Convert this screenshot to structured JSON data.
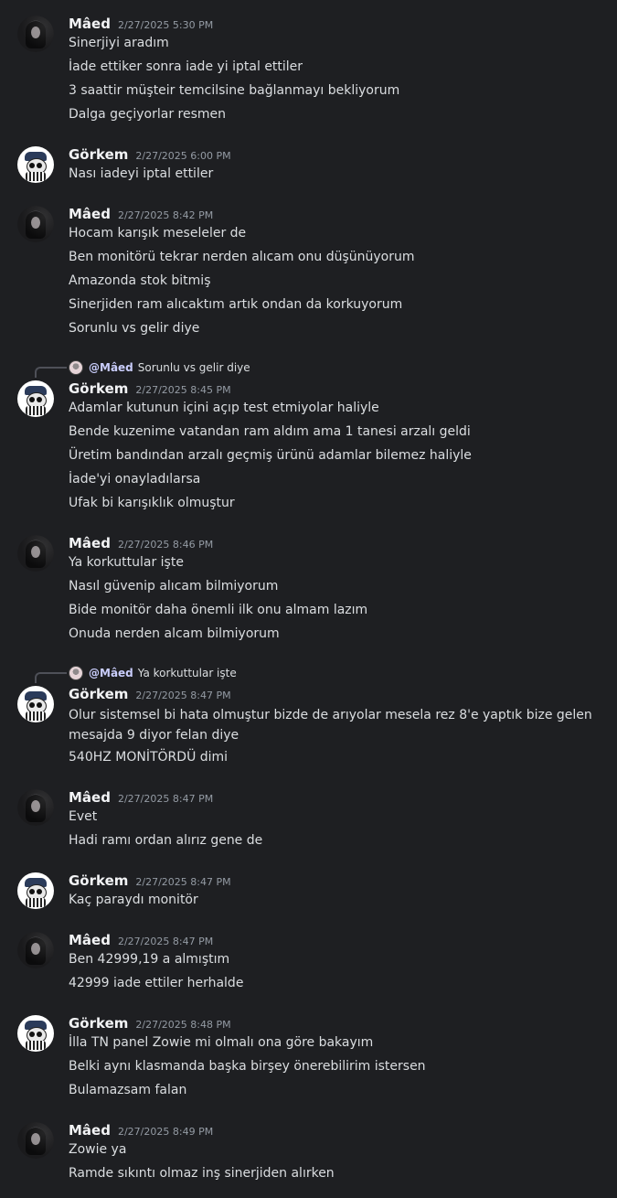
{
  "messages": [
    {
      "author": "Mâed",
      "avatar": "maed-avatar",
      "time": "2/27/2025 5:30 PM",
      "lines": [
        "Sinerjiyi aradım",
        "İade ettiker sonra iade yi iptal ettiler",
        "3 saattir müşteir temcilsine bağlanmayı bekliyorum",
        "Dalga geçiyorlar resmen"
      ]
    },
    {
      "author": "Görkem",
      "avatar": "gorkem-avatar",
      "time": "2/27/2025 6:00 PM",
      "lines": [
        "Nası iadeyi iptal ettiler"
      ]
    },
    {
      "author": "Mâed",
      "avatar": "maed-avatar",
      "time": "2/27/2025 8:42 PM",
      "lines": [
        "Hocam karışık meseleler de",
        "Ben monitörü tekrar nerden alıcam onu düşünüyorum",
        "Amazonda stok bitmiş",
        "Sinerjiden ram alıcaktım artık ondan da korkuyorum",
        "Sorunlu vs gelir diye"
      ]
    },
    {
      "author": "Görkem",
      "avatar": "gorkem-avatar",
      "time": "2/27/2025 8:45 PM",
      "reply": {
        "mention": "@Mâed",
        "text": "Sorunlu vs gelir diye"
      },
      "lines": [
        "Adamlar kutunun içini açıp test etmiyolar haliyle",
        "Bende kuzenime vatandan ram aldım ama 1 tanesi arzalı geldi",
        "Üretim bandından arzalı geçmiş ürünü adamlar bilemez haliyle",
        "İade'yi onayladılarsa",
        "Ufak bi karışıklık olmuştur"
      ]
    },
    {
      "author": "Mâed",
      "avatar": "maed-avatar",
      "time": "2/27/2025 8:46 PM",
      "lines": [
        "Ya korkuttular işte",
        "Nasıl güvenip alıcam bilmiyorum",
        "Bide monitör daha önemli ilk onu almam lazım",
        "Onuda nerden alcam bilmiyorum"
      ]
    },
    {
      "author": "Görkem",
      "avatar": "gorkem-avatar",
      "time": "2/27/2025 8:47 PM",
      "reply": {
        "mention": "@Mâed",
        "text": "Ya korkuttular işte"
      },
      "lines": [
        "Olur sistemsel bi hata olmuştur bizde de arıyolar mesela rez 8'e yaptık bize gelen mesajda 9 diyor felan diye",
        "540HZ MONİTÖRDÜ dimi"
      ]
    },
    {
      "author": "Mâed",
      "avatar": "maed-avatar",
      "time": "2/27/2025 8:47 PM",
      "lines": [
        "Evet",
        "Hadi ramı ordan alırız gene de"
      ]
    },
    {
      "author": "Görkem",
      "avatar": "gorkem-avatar",
      "time": "2/27/2025 8:47 PM",
      "lines": [
        "Kaç paraydı monitör"
      ]
    },
    {
      "author": "Mâed",
      "avatar": "maed-avatar",
      "time": "2/27/2025 8:47 PM",
      "lines": [
        "Ben 42999,19 a almıştım",
        "42999 iade ettiler herhalde"
      ]
    },
    {
      "author": "Görkem",
      "avatar": "gorkem-avatar",
      "time": "2/27/2025 8:48 PM",
      "lines": [
        "İlla TN panel Zowie mi olmalı ona göre bakayım",
        "Belki aynı klasmanda başka birşey önerebilirim istersen",
        "Bulamazsam falan"
      ]
    },
    {
      "author": "Mâed",
      "avatar": "maed-avatar",
      "time": "2/27/2025 8:49 PM",
      "lines": [
        "Zowie ya",
        "Ramde sıkıntı olmaz inş sinerjiden alırken"
      ]
    }
  ]
}
